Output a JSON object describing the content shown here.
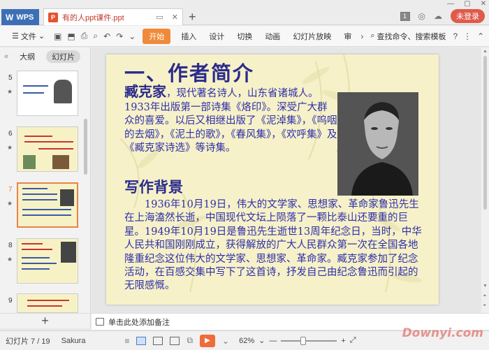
{
  "titlebar": {
    "wps_label": "WPS",
    "doc_title": "有的人ppt课件.ppt",
    "page_badge": "1",
    "login_label": "未登录",
    "new_tab_glyph": "+"
  },
  "ribbon": {
    "file_label": "文件",
    "start_label": "开始",
    "tabs": [
      "插入",
      "设计",
      "切换",
      "动画",
      "幻灯片放映",
      "审"
    ],
    "search_label": "查找命令、搜索模板"
  },
  "left_panel": {
    "outline_label": "大纲",
    "slides_label": "幻灯片",
    "thumbnails": [
      {
        "num": "5"
      },
      {
        "num": "6"
      },
      {
        "num": "7"
      },
      {
        "num": "8"
      },
      {
        "num": "9"
      }
    ]
  },
  "slide": {
    "title": "一、作者简介",
    "author_name": "臧克家",
    "bio": "，现代著名诗人，山东省诸城人。1933年出版第一部诗集《烙印》。深受广大群众的喜爱。以后又相继出版了《泥淖集》，《呜咽的去烟》，《泥土的歌》，《春风集》，《欢呼集》及《臧克家诗选》等诗集。",
    "subtitle": "写作背景",
    "body": "1936年10月19日，伟大的文学家、思想家、革命家鲁迅先生在上海溘然长逝，中国现代文坛上陨落了一颗比泰山还要重的巨星。1949年10月19日是鲁迅先生逝世13周年纪念日，当时，中华人民共和国刚刚成立，获得解放的广大人民群众第一次在全国各地隆重纪念这位伟大的文学家、思想家、革命家。臧克家参加了纪念活动，在百感交集中写下了这首诗，抒发自己由纪念鲁迅而引起的无限感慨。"
  },
  "notes": {
    "placeholder": "单击此处添加备注"
  },
  "status": {
    "slide_counter": "幻灯片 7 / 19",
    "theme": "Sakura",
    "zoom": "62%",
    "zoom_level": 0.62
  },
  "watermark": "Downyi.com",
  "colors": {
    "accent": "#f08a3a",
    "wps_blue": "#3d6fb5",
    "slide_bg": "#f6f1c8",
    "slide_text": "#2e2eaa"
  }
}
